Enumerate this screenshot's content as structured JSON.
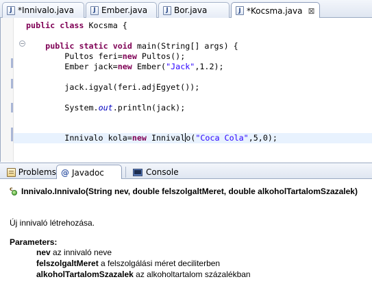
{
  "editor_tabs": [
    {
      "label": "*Innivalo.java",
      "active": false
    },
    {
      "label": "Ember.java",
      "active": false
    },
    {
      "label": "Bor.java",
      "active": false
    },
    {
      "label": "*Kocsma.java",
      "active": true
    }
  ],
  "editor_tab_close_glyph": "⊠",
  "code": {
    "line1": {
      "kw1": "public",
      "kw2": "class",
      "rest": " Kocsma {"
    },
    "line2": {
      "kw1": "public",
      "kw2": "static",
      "kw3": "void",
      "rest": " main(String[] args) {"
    },
    "line3": {
      "a": "Pultos feri=",
      "kw": "new",
      "b": " Pultos();"
    },
    "line4": {
      "a": "Ember jack=",
      "kw": "new",
      "b": " Ember(",
      "str": "\"Jack\"",
      "c": ",1.2);"
    },
    "line5": "jack.igyal(feri.adjEgyet());",
    "line6": {
      "a": "System.",
      "field": "out",
      "b": ".println(jack);"
    },
    "line7": {
      "a": "Innivalo kola=",
      "kw": "new",
      "b": " Innival",
      "b2": "o(",
      "str": "\"Coca Cola\"",
      "c": ",5,0);"
    }
  },
  "view_tabs": [
    {
      "label": "Problems",
      "icon": "problems-icon",
      "active": false
    },
    {
      "label": "Javadoc",
      "icon": "at-icon",
      "active": true
    },
    {
      "label": "Console",
      "icon": "console-icon",
      "active": false
    }
  ],
  "javadoc": {
    "signature": "Innivalo.Innivalo(String nev, double felszolgaltMeret, double alkoholTartalomSzazalek)",
    "description": "Új innivaló létrehozása.",
    "parameters_heading": "Parameters:",
    "params": [
      {
        "name": "nev",
        "desc": " az innivaló neve"
      },
      {
        "name": "felszolgaltMeret",
        "desc": " a felszolgálási méret deciliterben"
      },
      {
        "name": "alkoholTartalomSzazalek",
        "desc": " az alkoholtartalom százalékban"
      }
    ]
  },
  "colors": {
    "keyword": "#7f0055",
    "string": "#2a00ff",
    "static_field": "#0000c0",
    "current_line": "#e8f2fe"
  }
}
